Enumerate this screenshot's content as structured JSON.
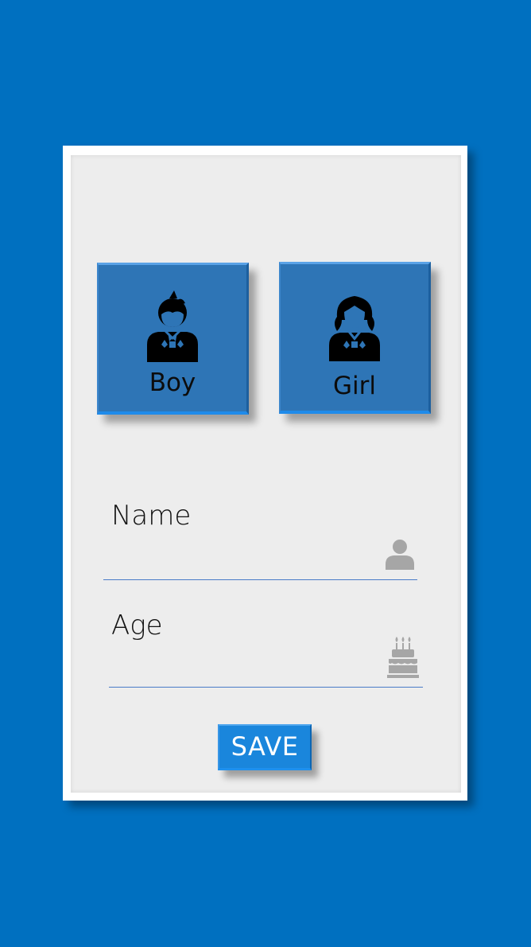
{
  "gender": {
    "options": [
      {
        "label": "Boy",
        "icon": "boy-avatar-icon"
      },
      {
        "label": "Girl",
        "icon": "girl-avatar-icon"
      }
    ]
  },
  "form": {
    "name": {
      "label": "Name",
      "value": "",
      "placeholder": "",
      "icon": "person-icon"
    },
    "age": {
      "label": "Age",
      "value": "",
      "placeholder": "",
      "icon": "birthday-cake-icon"
    }
  },
  "save_label": "SAVE",
  "colors": {
    "background": "#0070c0",
    "tile": "#2e75b6",
    "button": "#1a86dc",
    "field_line": "#4a7bc8",
    "field_icon": "#a6a6a6"
  }
}
